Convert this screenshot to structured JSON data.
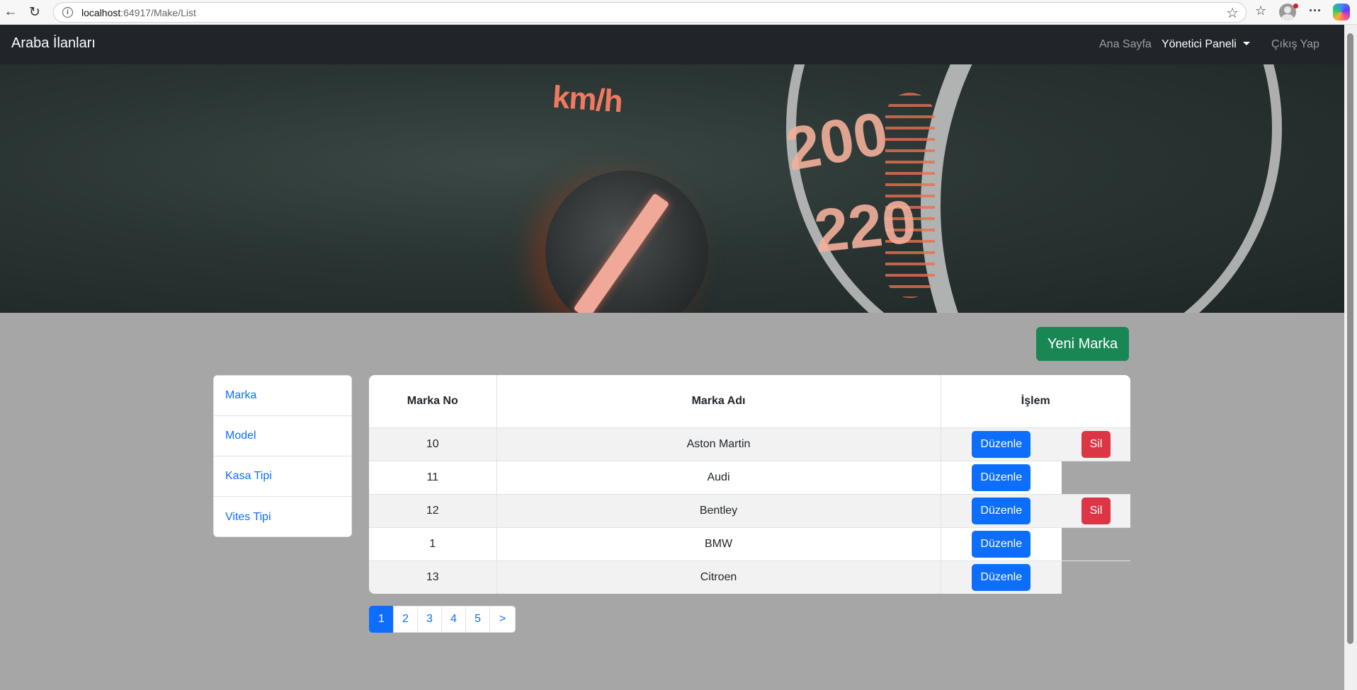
{
  "browser": {
    "url_host": "localhost",
    "url_path": ":64917/Make/List"
  },
  "navbar": {
    "brand": "Araba İlanları",
    "links": [
      {
        "label": "Ana Sayfa"
      },
      {
        "label": "Yönetici Paneli"
      },
      {
        "label": "Çıkış Yap"
      }
    ]
  },
  "hero": {
    "unit": "km/h",
    "gauge_numbers": [
      "200",
      "220"
    ]
  },
  "actions": {
    "new_label": "Yeni Marka"
  },
  "sidebar": {
    "items": [
      {
        "label": "Marka"
      },
      {
        "label": "Model"
      },
      {
        "label": "Kasa Tipi"
      },
      {
        "label": "Vites Tipi"
      }
    ]
  },
  "table": {
    "headers": [
      "Marka No",
      "Marka Adı",
      "İşlem"
    ],
    "edit_label": "Düzenle",
    "delete_label": "Sil",
    "rows": [
      {
        "id": "10",
        "name": "Aston Martin"
      },
      {
        "id": "11",
        "name": "Audi"
      },
      {
        "id": "12",
        "name": "Bentley"
      },
      {
        "id": "1",
        "name": "BMW"
      },
      {
        "id": "13",
        "name": "Citroen"
      }
    ]
  },
  "pagination": {
    "pages": [
      "1",
      "2",
      "3",
      "4",
      "5",
      ">"
    ],
    "active": "1"
  },
  "colors": {
    "navbar_bg": "#212529",
    "page_bg": "#a6a6a6",
    "primary": "#0d6efd",
    "success": "#198754",
    "danger": "#dc3545"
  }
}
